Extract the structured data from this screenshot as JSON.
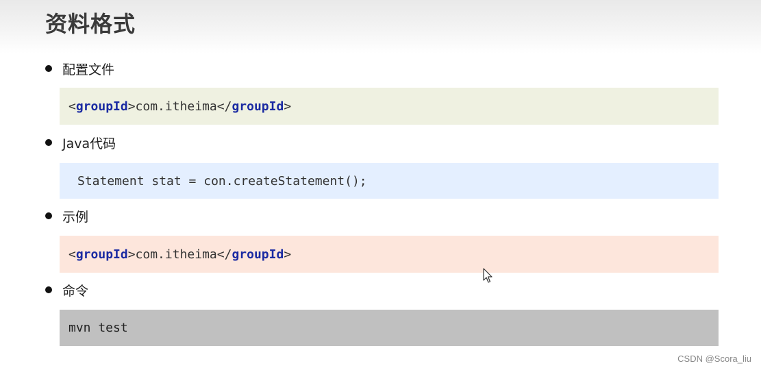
{
  "title": "资料格式",
  "sections": [
    {
      "label": "配置文件",
      "code": {
        "lt": "<",
        "tag": "groupId",
        "content": "com.itheima",
        "close_open": "</",
        "gt": ">"
      }
    },
    {
      "label": "Java代码",
      "code_text": "Statement stat = con.createStatement();"
    },
    {
      "label": "示例",
      "code": {
        "lt": "<",
        "tag": "groupId",
        "content": "com.itheima",
        "close_open": "</",
        "gt": ">"
      }
    },
    {
      "label": "命令",
      "code_text": "mvn test"
    }
  ],
  "block_colors": [
    "#eff1e1",
    "#e4efff",
    "#fde6dc",
    "#c0c0c0"
  ],
  "keyword_color": "#1a2aa2",
  "cursor_icon": "mouse-pointer-icon",
  "watermark": "CSDN @Scora_liu"
}
